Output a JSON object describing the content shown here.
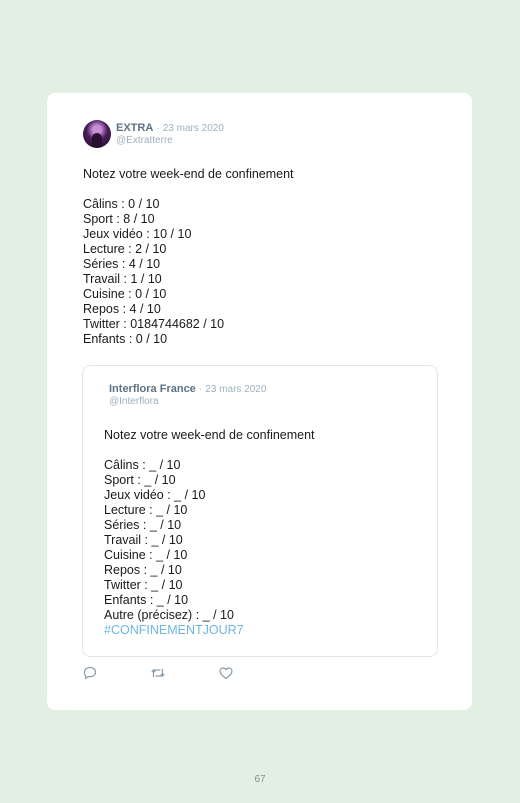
{
  "tweet": {
    "author": "EXTRA",
    "separator": "·",
    "date": "23 mars 2020",
    "handle": "@Extratterre",
    "text": "Notez votre week-end de confinement\n\nCâlins : 0 / 10\nSport : 8 / 10\nJeux vidéo : 10 / 10\nLecture : 2 / 10\nSéries : 4 / 10\nTravail : 1 / 10\nCuisine : 0 / 10\nRepos : 4 / 10\nTwitter : 0184744682 / 10\nEnfants : 0 / 10"
  },
  "quoted_tweet": {
    "author": "Interflora France",
    "separator": "·",
    "date": "23 mars 2020",
    "handle": "@Interflora",
    "text": "Notez votre week-end de confinement\n\nCâlins : _ / 10\nSport : _ / 10\nJeux vidéo : _ / 10\nLecture : _ / 10\nSéries : _ / 10\nTravail : _ / 10\nCuisine : _ / 10\nRepos : _ / 10\nTwitter : _ / 10\nEnfants : _ / 10\nAutre (précisez) : _ / 10",
    "hashtag": "#CONFINEMENTJOUR7"
  },
  "actions": {
    "reply_icon": "reply-icon",
    "retweet_icon": "retweet-icon",
    "like_icon": "heart-icon"
  },
  "colors": {
    "background": "#e1f0e3",
    "card": "#ffffff",
    "author": "#5c7385",
    "meta": "#9fb1bd",
    "hashtag": "#6fb7e0"
  },
  "page": {
    "number": "67"
  }
}
